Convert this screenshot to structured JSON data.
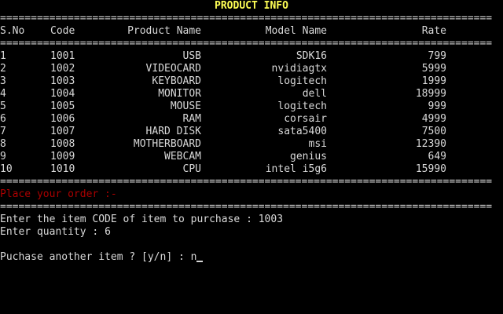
{
  "title": "PRODUCT INFO",
  "rule": "================================================================================",
  "headers": {
    "sno": "S.No",
    "code": "Code",
    "product_name": "Product Name",
    "model_name": "Model Name",
    "rate": "Rate"
  },
  "products": [
    {
      "sno": "1",
      "code": "1001",
      "name": "USB",
      "model": "SDK16",
      "rate": "799"
    },
    {
      "sno": "2",
      "code": "1002",
      "name": "VIDEOCARD",
      "model": "nvidiagtx",
      "rate": "5999"
    },
    {
      "sno": "3",
      "code": "1003",
      "name": "KEYBOARD",
      "model": "logitech",
      "rate": "1999"
    },
    {
      "sno": "4",
      "code": "1004",
      "name": "MONITOR",
      "model": "dell",
      "rate": "18999"
    },
    {
      "sno": "5",
      "code": "1005",
      "name": "MOUSE",
      "model": "logitech",
      "rate": "999"
    },
    {
      "sno": "6",
      "code": "1006",
      "name": "RAM",
      "model": "corsair",
      "rate": "4999"
    },
    {
      "sno": "7",
      "code": "1007",
      "name": "HARD DISK",
      "model": "sata5400",
      "rate": "7500"
    },
    {
      "sno": "8",
      "code": "1008",
      "name": "MOTHERBOARD",
      "model": "msi",
      "rate": "12390"
    },
    {
      "sno": "9",
      "code": "1009",
      "name": "WEBCAM",
      "model": "genius",
      "rate": "649"
    },
    {
      "sno": "10",
      "code": "1010",
      "name": "CPU",
      "model": "intel i5g6",
      "rate": "15990"
    }
  ],
  "order": {
    "heading": "Place your order :-",
    "code_prompt": "Enter the item CODE of item to purchase : ",
    "code_value": "1003",
    "qty_prompt": "Enter quantity : ",
    "qty_value": "6",
    "another_prompt": "Puchase another item ? [y/n] : ",
    "another_value": "n"
  },
  "colors": {
    "background": "#000000",
    "text": "#d9d9d9",
    "title": "#ffff55",
    "heading_red": "#aa0000"
  }
}
